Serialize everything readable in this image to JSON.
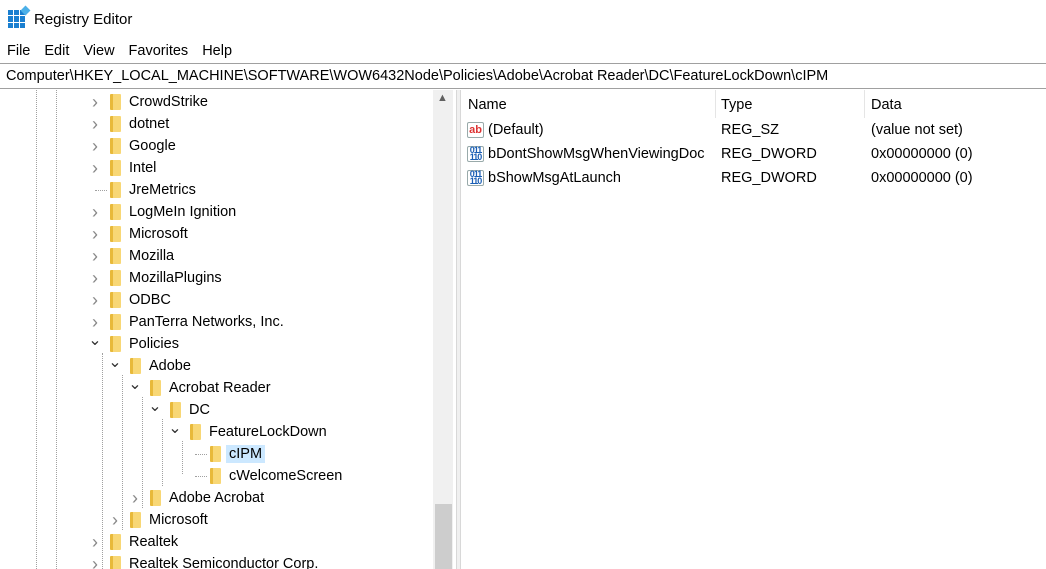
{
  "window": {
    "title": "Registry Editor"
  },
  "menu": [
    "File",
    "Edit",
    "View",
    "Favorites",
    "Help"
  ],
  "address": "Computer\\HKEY_LOCAL_MACHINE\\SOFTWARE\\WOW6432Node\\Policies\\Adobe\\Acrobat Reader\\DC\\FeatureLockDown\\cIPM",
  "tree": [
    {
      "label": "CrowdStrike",
      "depth": 0,
      "state": "collapsed"
    },
    {
      "label": "dotnet",
      "depth": 0,
      "state": "collapsed"
    },
    {
      "label": "Google",
      "depth": 0,
      "state": "collapsed"
    },
    {
      "label": "Intel",
      "depth": 0,
      "state": "collapsed"
    },
    {
      "label": "JreMetrics",
      "depth": 0,
      "state": "leaf"
    },
    {
      "label": "LogMeIn Ignition",
      "depth": 0,
      "state": "collapsed"
    },
    {
      "label": "Microsoft",
      "depth": 0,
      "state": "collapsed"
    },
    {
      "label": "Mozilla",
      "depth": 0,
      "state": "collapsed"
    },
    {
      "label": "MozillaPlugins",
      "depth": 0,
      "state": "collapsed"
    },
    {
      "label": "ODBC",
      "depth": 0,
      "state": "collapsed"
    },
    {
      "label": "PanTerra Networks, Inc.",
      "depth": 0,
      "state": "collapsed"
    },
    {
      "label": "Policies",
      "depth": 0,
      "state": "expanded"
    },
    {
      "label": "Adobe",
      "depth": 1,
      "state": "expanded"
    },
    {
      "label": "Acrobat Reader",
      "depth": 2,
      "state": "expanded"
    },
    {
      "label": "DC",
      "depth": 3,
      "state": "expanded"
    },
    {
      "label": "FeatureLockDown",
      "depth": 4,
      "state": "expanded"
    },
    {
      "label": "cIPM",
      "depth": 5,
      "state": "leaf",
      "selected": true
    },
    {
      "label": "cWelcomeScreen",
      "depth": 5,
      "state": "leaf"
    },
    {
      "label": "Adobe Acrobat",
      "depth": 2,
      "state": "collapsed"
    },
    {
      "label": "Microsoft",
      "depth": 1,
      "state": "collapsed"
    },
    {
      "label": "Realtek",
      "depth": 0,
      "state": "collapsed"
    },
    {
      "label": "Realtek Semiconductor Corp.",
      "depth": 0,
      "state": "collapsed"
    }
  ],
  "columns": {
    "name": "Name",
    "type": "Type",
    "data": "Data"
  },
  "values": [
    {
      "name": "(Default)",
      "type": "REG_SZ",
      "data": "(value not set)",
      "icon": "string-value-icon"
    },
    {
      "name": "bDontShowMsgWhenViewingDoc",
      "type": "REG_DWORD",
      "data": "0x00000000 (0)",
      "icon": "binary-value-icon"
    },
    {
      "name": "bShowMsgAtLaunch",
      "type": "REG_DWORD",
      "data": "0x00000000 (0)",
      "icon": "binary-value-icon"
    }
  ]
}
